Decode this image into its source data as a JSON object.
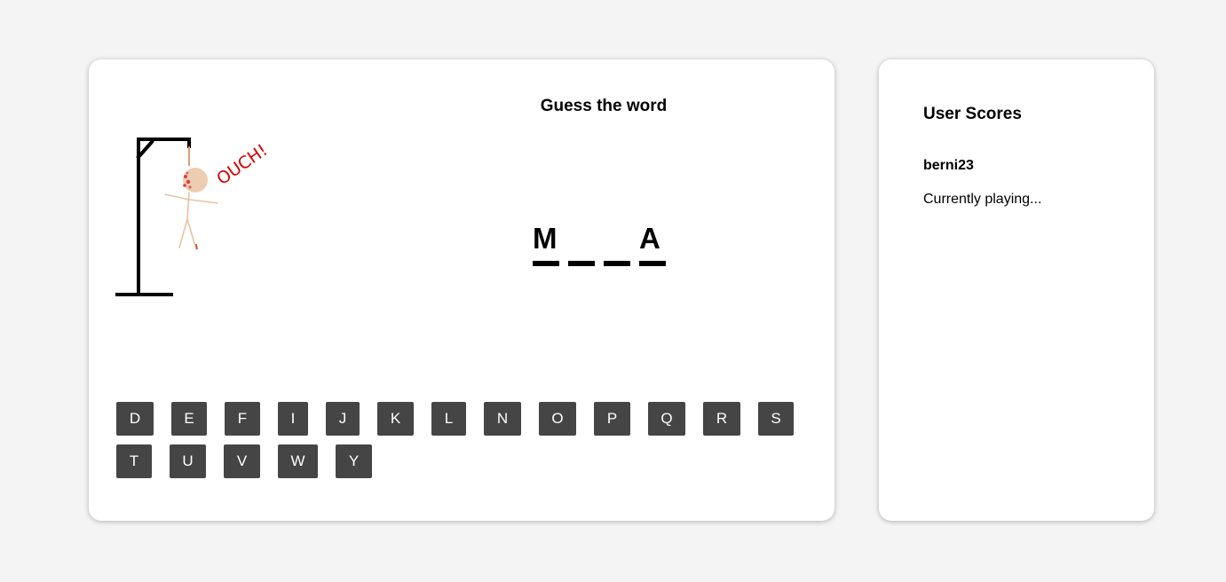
{
  "game": {
    "title": "Guess the word",
    "ouch_text": "OUCH!",
    "word_slots": [
      "M",
      "",
      "",
      "A"
    ],
    "keyboard": {
      "row1": [
        "D",
        "E",
        "F",
        "I",
        "J",
        "K",
        "L",
        "N",
        "O",
        "P",
        "Q",
        "R",
        "S"
      ],
      "row2": [
        "T",
        "U",
        "V",
        "W",
        "Y"
      ]
    }
  },
  "scores": {
    "title": "User Scores",
    "players": [
      {
        "name": "berni23",
        "status": "Currently playing..."
      }
    ]
  },
  "colors": {
    "background": "#f4f4f4",
    "card": "#ffffff",
    "key_background": "#454545",
    "key_text": "#ffffff",
    "ouch": "#d40000",
    "skin": "#eccdb1",
    "blood": "#d94040"
  }
}
